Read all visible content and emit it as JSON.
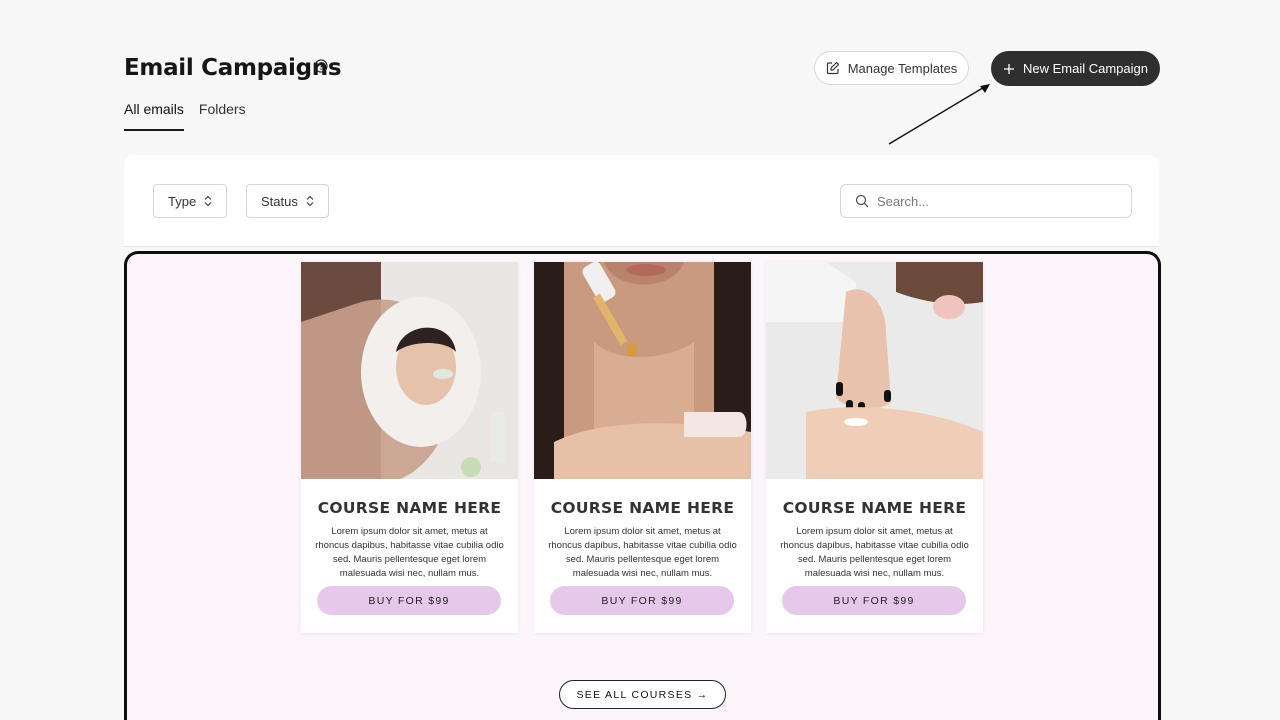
{
  "header": {
    "title": "Email Campaigns",
    "manage_templates_label": "Manage Templates",
    "new_campaign_label": "New Email Campaign"
  },
  "tabs": [
    {
      "label": "All emails",
      "active": true
    },
    {
      "label": "Folders",
      "active": false
    }
  ],
  "filters": {
    "type_label": "Type",
    "status_label": "Status",
    "search_placeholder": "Search..."
  },
  "preview": {
    "cards": [
      {
        "title": "COURSE NAME HERE",
        "description": "Lorem ipsum dolor sit amet, metus at rhoncus dapibus, habitasse vitae cubilia odio sed. Mauris pellentesque eget lorem malesuada wisi nec, nullam mus.",
        "button_label": "BUY FOR $99",
        "image": "woman-mirror-eye-patch-photo"
      },
      {
        "title": "COURSE NAME HERE",
        "description": "Lorem ipsum dolor sit amet, metus at rhoncus dapibus, habitasse vitae cubilia odio sed. Mauris pellentesque eget lorem malesuada wisi nec, nullam mus.",
        "button_label": "BUY FOR $99",
        "image": "serum-dropper-neck-photo"
      },
      {
        "title": "COURSE NAME HERE",
        "description": "Lorem ipsum dolor sit amet, metus at rhoncus dapibus, habitasse vitae cubilia odio sed. Mauris pellentesque eget lorem malesuada wisi nec, nullam mus.",
        "button_label": "BUY FOR $99",
        "image": "cream-on-arm-photo"
      }
    ],
    "see_all_label": "SEE ALL COURSES →"
  },
  "colors": {
    "primary_button": "#2f2f2f",
    "card_button": "#e6c9ea",
    "preview_background": "#fcf6fc",
    "page_background": "#f7f7f7"
  }
}
